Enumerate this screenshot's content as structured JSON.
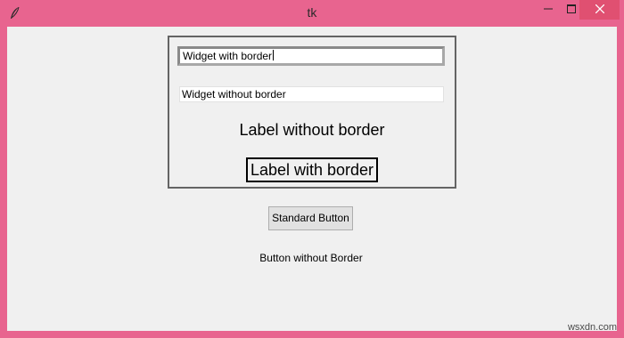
{
  "window": {
    "title": "tk",
    "icon": "feather-icon",
    "controls": {
      "minimize": "minimize-icon",
      "maximize": "maximize-icon",
      "close": "close-icon"
    }
  },
  "content": {
    "entry_with_border": "Widget with border",
    "entry_without_border": "Widget without border",
    "label_without_border": "Label without border",
    "label_with_border": "Label with border",
    "standard_button": "Standard Button",
    "button_without_border": "Button without Border"
  },
  "watermark": "wsxdn.com",
  "colors": {
    "frame": "#e8648f",
    "close_button": "#e05071",
    "client_bg": "#f0f0f0"
  }
}
